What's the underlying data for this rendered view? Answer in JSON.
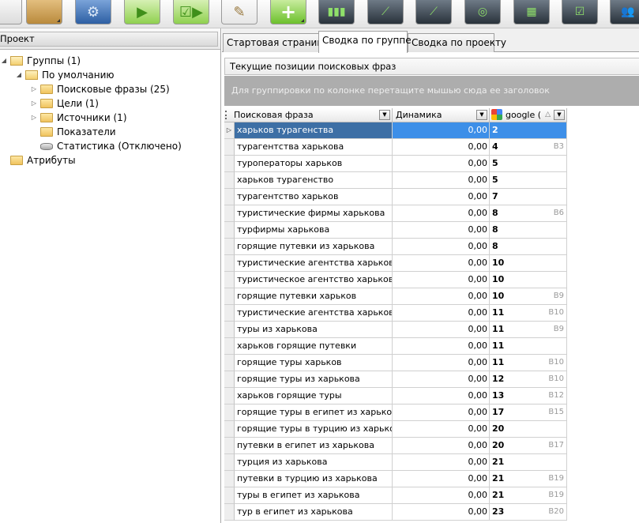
{
  "toolbar": {
    "buttons": [
      {
        "name": "blank-button",
        "icon": ""
      },
      {
        "name": "folder-button",
        "icon": ""
      },
      {
        "name": "settings-button",
        "icon": "⚙"
      },
      {
        "name": "run-button",
        "icon": "▶"
      },
      {
        "name": "run-checked-button",
        "icon": "☑▶"
      },
      {
        "name": "edit-button",
        "icon": "✎"
      },
      {
        "name": "add-button",
        "icon": "+"
      },
      {
        "name": "report-chart-button",
        "icon": "▮▮▮"
      },
      {
        "name": "report-line-button",
        "icon": "⟋"
      },
      {
        "name": "report-trend-button",
        "icon": "⟋"
      },
      {
        "name": "report-target-button",
        "icon": "◎"
      },
      {
        "name": "report-calendar-button",
        "icon": "▦"
      },
      {
        "name": "report-check-button",
        "icon": "☑"
      },
      {
        "name": "users-button",
        "icon": "👥"
      }
    ]
  },
  "project_panel": {
    "title": "Проект",
    "tree": [
      {
        "label": "Группы (1)",
        "level": 0,
        "arrow": "◢",
        "icon": "folder-open"
      },
      {
        "label": "По умолчанию",
        "level": 1,
        "arrow": "◢",
        "icon": "folder-open"
      },
      {
        "label": "Поисковые фразы (25)",
        "level": 2,
        "arrow": "▷",
        "icon": "folder"
      },
      {
        "label": "Цели (1)",
        "level": 2,
        "arrow": "▷",
        "icon": "folder"
      },
      {
        "label": "Источники (1)",
        "level": 2,
        "arrow": "▷",
        "icon": "folder"
      },
      {
        "label": "Показатели",
        "level": 2,
        "arrow": "",
        "icon": "folder"
      },
      {
        "label": "Статистика (Отключено)",
        "level": 2,
        "arrow": "",
        "icon": "disk"
      },
      {
        "label": "Атрибуты",
        "level": 0,
        "arrow": "",
        "icon": "folder"
      }
    ]
  },
  "tabs": [
    {
      "label": "Стартовая страница",
      "active": false
    },
    {
      "label": "Сводка по группе",
      "active": true
    },
    {
      "label": "Сводка по проекту",
      "active": false
    }
  ],
  "grid": {
    "title": "Текущие позиции поисковых фраз",
    "group_hint": "Для группировки по колонке перетащите мышью сюда ее заголовок",
    "columns": {
      "phrase": "Поисковая фраза",
      "dynamics": "Динамика",
      "google": "google ("
    },
    "rows": [
      {
        "phrase": "харьков турагенства",
        "dynamics": "0,00",
        "position": "2",
        "ref": "",
        "selected": true
      },
      {
        "phrase": "турагентства харькова",
        "dynamics": "0,00",
        "position": "4",
        "ref": "B3",
        "selected": false
      },
      {
        "phrase": "туроператоры харьков",
        "dynamics": "0,00",
        "position": "5",
        "ref": "",
        "selected": false
      },
      {
        "phrase": "харьков турагенство",
        "dynamics": "0,00",
        "position": "5",
        "ref": "",
        "selected": false
      },
      {
        "phrase": "турагентство харьков",
        "dynamics": "0,00",
        "position": "7",
        "ref": "",
        "selected": false
      },
      {
        "phrase": "туристические фирмы харькова",
        "dynamics": "0,00",
        "position": "8",
        "ref": "B6",
        "selected": false
      },
      {
        "phrase": "турфирмы харькова",
        "dynamics": "0,00",
        "position": "8",
        "ref": "",
        "selected": false
      },
      {
        "phrase": "горящие путевки из харькова",
        "dynamics": "0,00",
        "position": "8",
        "ref": "",
        "selected": false
      },
      {
        "phrase": "туристические агентства харьков",
        "dynamics": "0,00",
        "position": "10",
        "ref": "",
        "selected": false
      },
      {
        "phrase": "туристическое агентство харьков",
        "dynamics": "0,00",
        "position": "10",
        "ref": "",
        "selected": false
      },
      {
        "phrase": "горящие путевки харьков",
        "dynamics": "0,00",
        "position": "10",
        "ref": "B9",
        "selected": false
      },
      {
        "phrase": "туристические агентства харькова",
        "dynamics": "0,00",
        "position": "11",
        "ref": "B10",
        "selected": false
      },
      {
        "phrase": "туры из харькова",
        "dynamics": "0,00",
        "position": "11",
        "ref": "B9",
        "selected": false
      },
      {
        "phrase": "харьков горящие путевки",
        "dynamics": "0,00",
        "position": "11",
        "ref": "",
        "selected": false
      },
      {
        "phrase": "горящие туры харьков",
        "dynamics": "0,00",
        "position": "11",
        "ref": "B10",
        "selected": false
      },
      {
        "phrase": "горящие туры из харькова",
        "dynamics": "0,00",
        "position": "12",
        "ref": "B10",
        "selected": false
      },
      {
        "phrase": "харьков горящие туры",
        "dynamics": "0,00",
        "position": "13",
        "ref": "B12",
        "selected": false
      },
      {
        "phrase": "горящие туры в египет из харькова",
        "dynamics": "0,00",
        "position": "17",
        "ref": "B15",
        "selected": false
      },
      {
        "phrase": "горящие туры в турцию из харькова",
        "dynamics": "0,00",
        "position": "20",
        "ref": "",
        "selected": false
      },
      {
        "phrase": "путевки в египет из харькова",
        "dynamics": "0,00",
        "position": "20",
        "ref": "B17",
        "selected": false
      },
      {
        "phrase": "турция из харькова",
        "dynamics": "0,00",
        "position": "21",
        "ref": "",
        "selected": false
      },
      {
        "phrase": "путевки в турцию из харькова",
        "dynamics": "0,00",
        "position": "21",
        "ref": "B19",
        "selected": false
      },
      {
        "phrase": "туры в египет из харькова",
        "dynamics": "0,00",
        "position": "21",
        "ref": "B19",
        "selected": false
      },
      {
        "phrase": "тур в египет из харькова",
        "dynamics": "0,00",
        "position": "23",
        "ref": "B20",
        "selected": false
      }
    ]
  }
}
